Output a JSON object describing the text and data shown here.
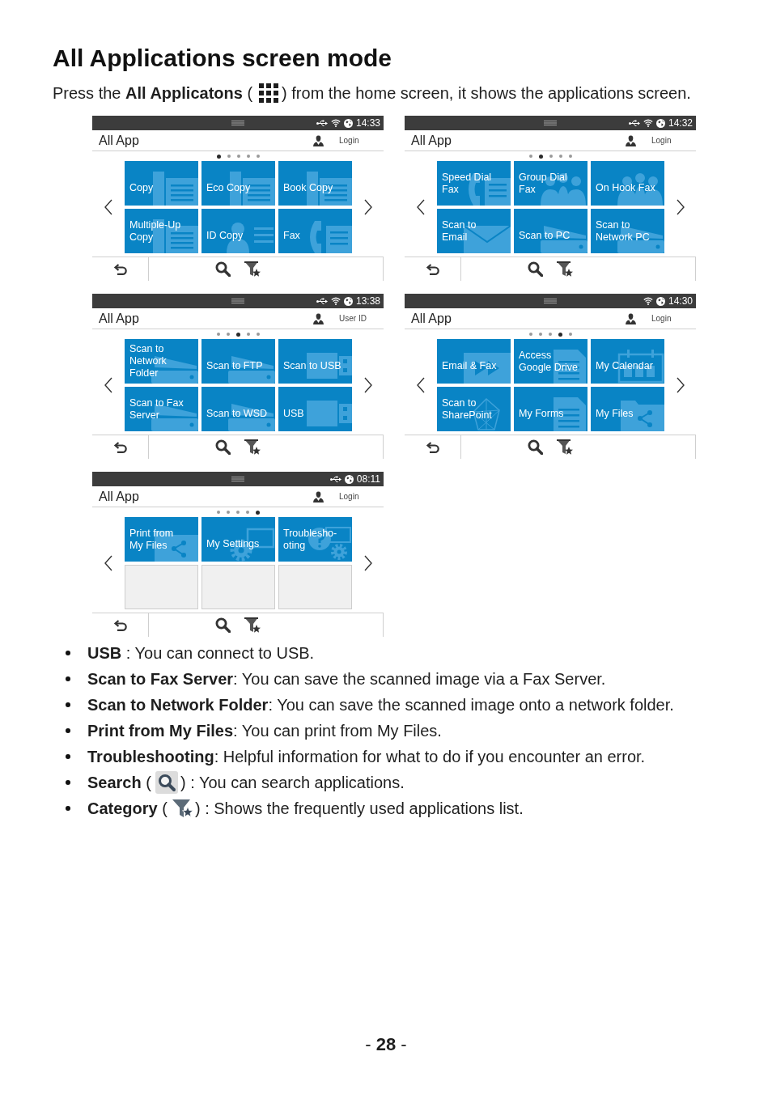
{
  "title": "All Applications screen mode",
  "intro": {
    "lead": "Press the **All Applicatons** (",
    "tail": ") from the home screen, it shows the applications screen."
  },
  "panels": [
    {
      "status": {
        "usb": true,
        "wifi": true,
        "time": "14:33"
      },
      "header": {
        "title": "All App",
        "account": "Login"
      },
      "page_dots": [
        {
          "selected": true
        },
        {
          "selected": false
        },
        {
          "selected": false
        },
        {
          "selected": false
        },
        {
          "selected": false
        }
      ],
      "tiles": [
        {
          "label": "Copy",
          "kind": "copy"
        },
        {
          "label": "Eco Copy",
          "kind": "copy"
        },
        {
          "label": "Book Copy",
          "kind": "copy"
        },
        {
          "label": "Multiple-Up\nCopy",
          "kind": "copy"
        },
        {
          "label": "ID Copy",
          "kind": "id"
        },
        {
          "label": "Fax",
          "kind": "phone"
        }
      ]
    },
    {
      "status": {
        "usb": true,
        "wifi": true,
        "time": "14:32"
      },
      "header": {
        "title": "All App",
        "account": "Login"
      },
      "page_dots": [
        {
          "selected": false
        },
        {
          "selected": true
        },
        {
          "selected": false
        },
        {
          "selected": false
        },
        {
          "selected": false
        }
      ],
      "tiles": [
        {
          "label": "Speed Dial\nFax",
          "kind": "phone"
        },
        {
          "label": "Group Dial\nFax",
          "kind": "people"
        },
        {
          "label": "On Hook Fax",
          "kind": "people"
        },
        {
          "label": "Scan to\nEmail",
          "kind": "envelope"
        },
        {
          "label": "Scan to PC",
          "kind": "scanner"
        },
        {
          "label": "Scan to\nNetwork PC",
          "kind": "scanner"
        }
      ]
    },
    {
      "status": {
        "usb": true,
        "wifi": true,
        "time": "13:38"
      },
      "header": {
        "title": "All App",
        "account": "User ID"
      },
      "page_dots": [
        {
          "selected": false
        },
        {
          "selected": false
        },
        {
          "selected": true
        },
        {
          "selected": false
        },
        {
          "selected": false
        }
      ],
      "tiles": [
        {
          "label": "Scan to\nNetwork\nFolder",
          "kind": "scanner"
        },
        {
          "label": "Scan to FTP",
          "kind": "scanner"
        },
        {
          "label": "Scan to USB",
          "kind": "usb"
        },
        {
          "label": "Scan to Fax\nServer",
          "kind": "scanner"
        },
        {
          "label": "Scan to WSD",
          "kind": "scanner"
        },
        {
          "label": "USB",
          "kind": "usb"
        }
      ]
    },
    {
      "status": {
        "usb": false,
        "wifi": true,
        "time": "14:30"
      },
      "header": {
        "title": "All App",
        "account": "Login"
      },
      "page_dots": [
        {
          "selected": false
        },
        {
          "selected": false
        },
        {
          "selected": false
        },
        {
          "selected": true
        },
        {
          "selected": false
        }
      ],
      "tiles": [
        {
          "label": "Email & Fax",
          "kind": "arrows"
        },
        {
          "label": "Access\nGoogle Drive",
          "kind": "document"
        },
        {
          "label": "My Calendar",
          "kind": "calendar"
        },
        {
          "label": "Scan to\nSharePoint",
          "kind": "mesh"
        },
        {
          "label": "My Forms",
          "kind": "document"
        },
        {
          "label": "My Files",
          "kind": "folder"
        }
      ]
    },
    {
      "status": {
        "usb": true,
        "wifi": false,
        "time": "08:11"
      },
      "header": {
        "title": "All App",
        "account": "Login"
      },
      "page_dots": [
        {
          "selected": false
        },
        {
          "selected": false
        },
        {
          "selected": false
        },
        {
          "selected": false
        },
        {
          "selected": true
        }
      ],
      "tiles": [
        {
          "label": "Print from\nMy Files",
          "kind": "folder"
        },
        {
          "label": "My Settings",
          "kind": "gear"
        },
        {
          "label": "Troublesho-\noting",
          "kind": "help"
        },
        {
          "kind": "empty"
        },
        {
          "kind": "empty"
        },
        {
          "kind": "empty"
        }
      ]
    }
  ],
  "bullets": [
    {
      "kind": "plain",
      "text": "**USB** : You can connect to USB."
    },
    {
      "kind": "plain",
      "text": "**Scan to Fax Server**: You can save the scanned image via a Fax Server."
    },
    {
      "kind": "plain",
      "text": "**Scan to Network Folder**: You can save the scanned image onto a network folder."
    },
    {
      "kind": "plain",
      "text": "**Print from My Files**: You can print from My Files."
    },
    {
      "kind": "plain",
      "text": "**Troubleshooting**: Helpful information for what to do if you encounter an error."
    },
    {
      "kind": "search",
      "lead": "**Search** (",
      "tail": ") : You can search applications."
    },
    {
      "kind": "category",
      "lead": "**Category** (",
      "tail": ") : Shows the frequently used applications list."
    }
  ],
  "page_number": "- **28** -"
}
